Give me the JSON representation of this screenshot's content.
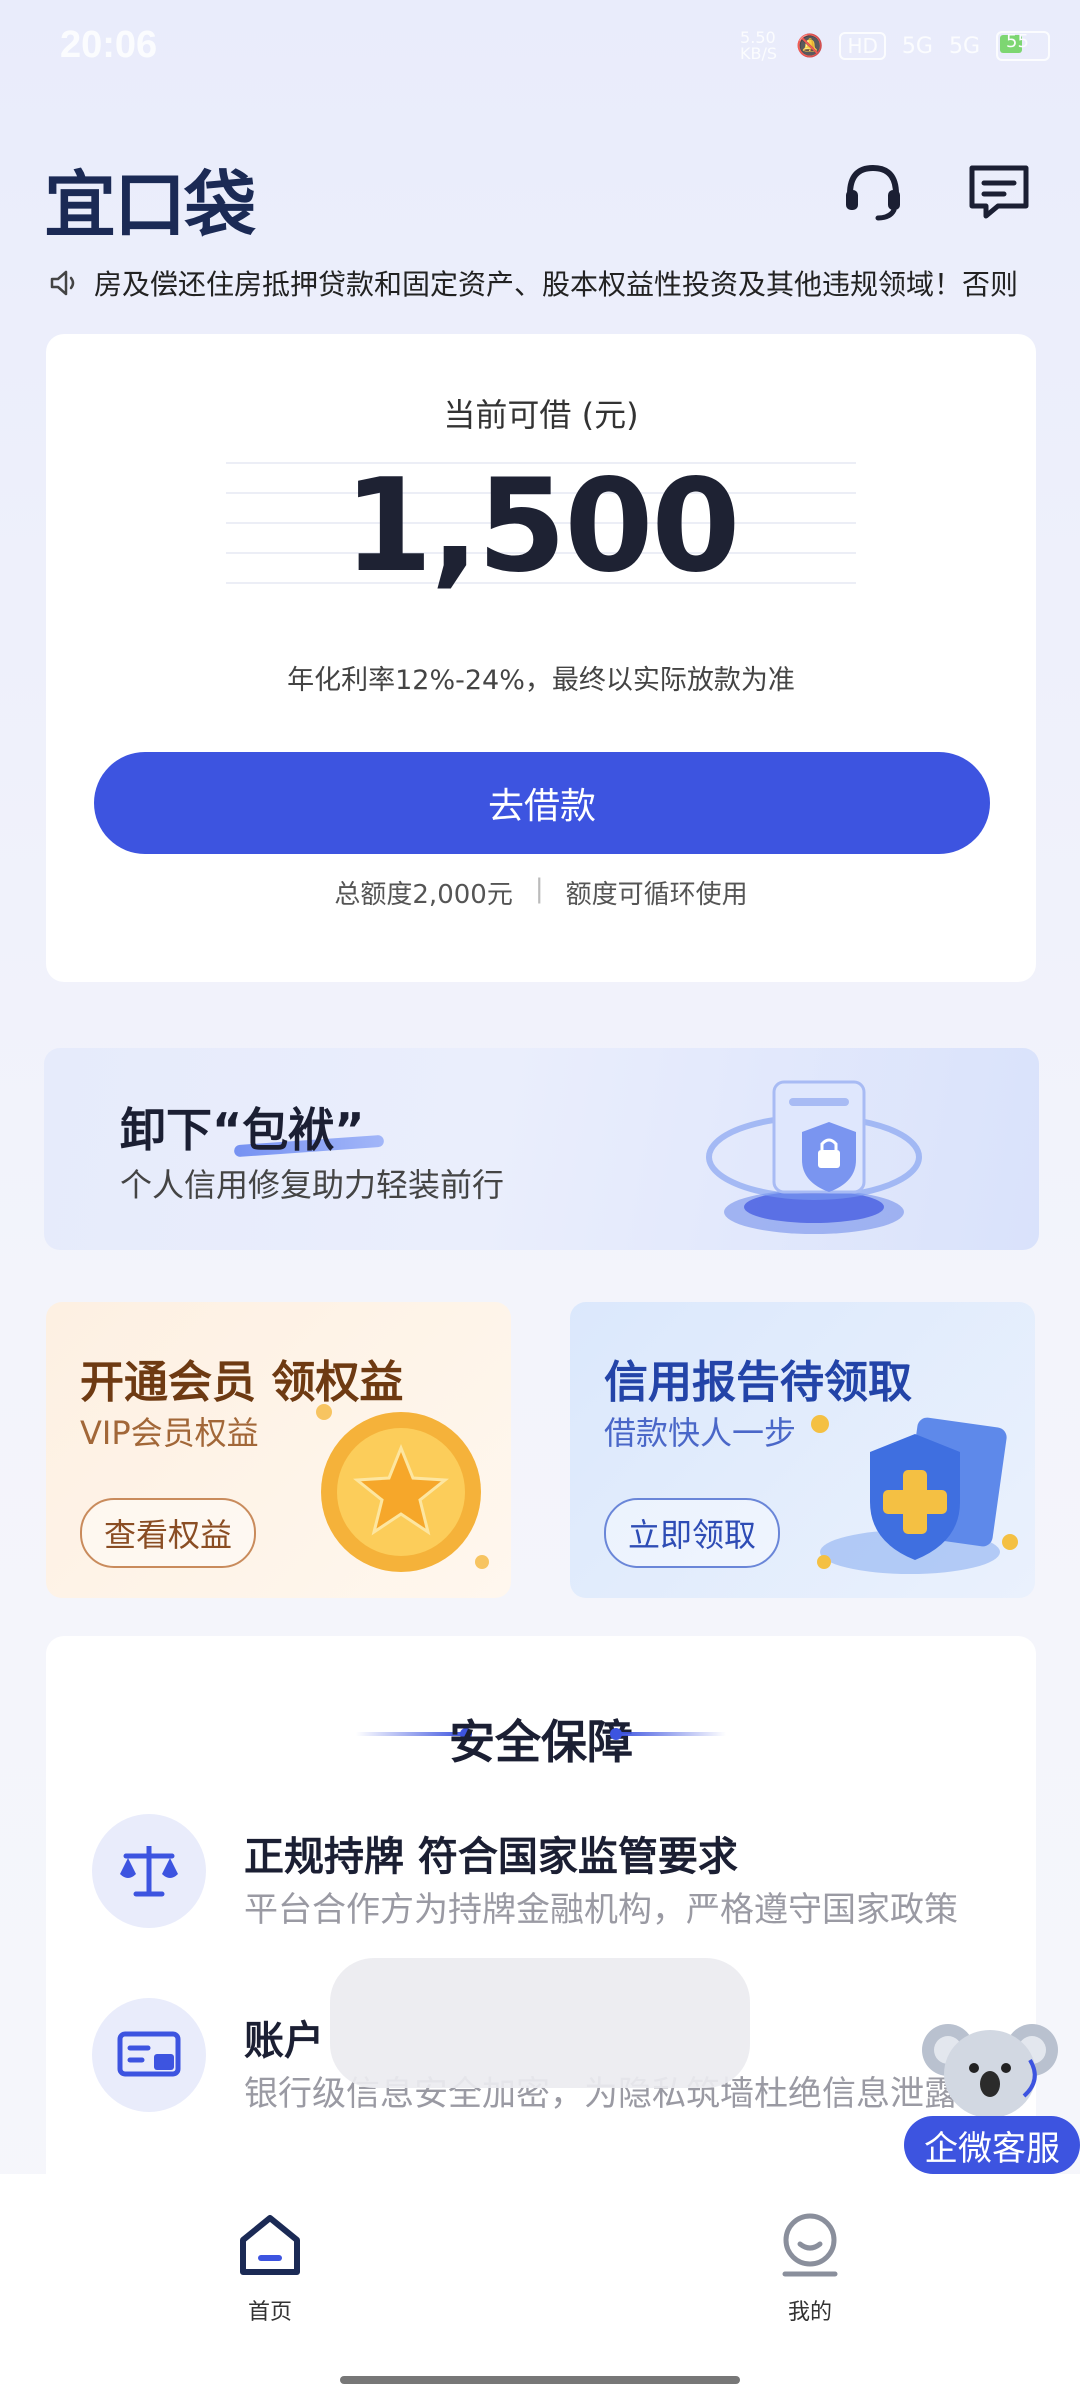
{
  "status_bar": {
    "time": "20:06",
    "net_speed": "5.50 KB/S",
    "hd_label": "HD",
    "signal_1": "5G",
    "signal_2": "5G",
    "battery": "55"
  },
  "header": {
    "logo": "宜口袋",
    "support_icon": "headset-icon",
    "message_icon": "message-icon"
  },
  "notice": {
    "icon": "speaker-icon",
    "text": "房及偿还住房抵押贷款和固定资产、股本权益性投资及其他违规领域！否则"
  },
  "quota": {
    "label": "当前可借 (元)",
    "amount": "1,500",
    "rate_note": "年化利率12%-24%，最终以实际放款为准",
    "borrow_button": "去借款",
    "total_limit": "总额度2,000元",
    "separator": "|",
    "recycle_note": "额度可循环使用"
  },
  "banner": {
    "title": "卸下“包袱”",
    "subtitle": "个人信用修复助力轻装前行",
    "icon": "security-lock-icon"
  },
  "vip_card": {
    "title": "开通会员 领权益",
    "subtitle": "VIP会员权益",
    "button": "查看权益",
    "icon": "star-coin-icon"
  },
  "credit_card": {
    "title": "信用报告待领取",
    "subtitle": "借款快人一步",
    "button": "立即领取",
    "icon": "shield-plus-icon"
  },
  "security": {
    "title": "安全保障",
    "items": [
      {
        "icon": "scale-icon",
        "title": "正规持牌 符合国家监管要求",
        "subtitle": "平台合作方为持牌金融机构，严格遵守国家政策"
      },
      {
        "icon": "id-card-icon",
        "title": "账户",
        "subtitle": "银行级信息安全加密，为隐私筑墙杜绝信息泄露"
      }
    ]
  },
  "float_service": {
    "label": "企微客服",
    "icon": "koala-mascot-icon"
  },
  "bottom_nav": {
    "items": [
      {
        "label": "首页",
        "icon": "home-icon"
      },
      {
        "label": "我的",
        "icon": "profile-icon"
      }
    ]
  },
  "colors": {
    "primary": "#3d54e0",
    "text_dark": "#1b1f33",
    "vip_brown": "#6e3a12",
    "credit_blue": "#2344a8"
  }
}
